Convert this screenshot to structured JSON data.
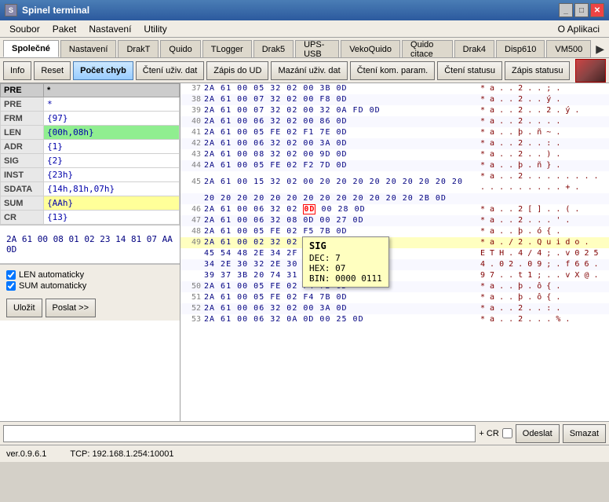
{
  "window": {
    "title": "Spinel terminal",
    "controls": [
      "_",
      "□",
      "✕"
    ]
  },
  "menu": {
    "items": [
      "Soubor",
      "Paket",
      "Nastavení",
      "Utility"
    ],
    "right": "O Aplikaci"
  },
  "tabs_top": {
    "items": [
      "Společné",
      "Nastavení",
      "DrakT",
      "Quido",
      "TLogger",
      "Drak5",
      "UPS-USB",
      "VekoQuido",
      "Quido citace",
      "Drak4",
      "Disp610",
      "VM500"
    ],
    "active": 0,
    "nav": "▶"
  },
  "buttons": {
    "items": [
      "Info",
      "Reset",
      "Počet chyb",
      "Čtení uživ. dat",
      "Zápis do UD",
      "Mazání uživ. dat",
      "Čtení kom. param.",
      "Čtení statusu",
      "Zápis statusu"
    ],
    "active": 2
  },
  "fields": [
    {
      "label": "PRE",
      "value": "*",
      "style": ""
    },
    {
      "label": "FRM",
      "value": "{97}",
      "style": ""
    },
    {
      "label": "LEN",
      "value": "{00h,08h}",
      "style": "green"
    },
    {
      "label": "ADR",
      "value": "{1}",
      "style": ""
    },
    {
      "label": "SIG",
      "value": "{2}",
      "style": ""
    },
    {
      "label": "INST",
      "value": "{23h}",
      "style": ""
    },
    {
      "label": "SDATA",
      "value": "{14h,81h,07h}",
      "style": ""
    },
    {
      "label": "SUM",
      "value": "{AAh}",
      "style": "yellow"
    },
    {
      "label": "CR",
      "value": "{13}",
      "style": ""
    }
  ],
  "hex_rows": [
    {
      "num": "37",
      "bytes": "2A 61 00 05 32 02 00 3B 0D",
      "ascii": "* a . . 2 . . ; ."
    },
    {
      "num": "38",
      "bytes": "2A 61 00 07 32 02 00 F8 0D",
      "ascii": "* a . . 2 . . ý ."
    },
    {
      "num": "39",
      "bytes": "2A 61 00 07 32 02 00 32 0A FD 0D",
      "ascii": "* a . . 2 . . 2 . ý ."
    },
    {
      "num": "40",
      "bytes": "2A 61 00 06 32 02 00 86 0D",
      "ascii": "* a . . 2 . . . ."
    },
    {
      "num": "41",
      "bytes": "2A 61 00 05 FE 02 F1 7E 0D",
      "ascii": "* a . . þ . ñ ~ ."
    },
    {
      "num": "42",
      "bytes": "2A 61 00 06 32 02 00 3A 0D",
      "ascii": "* a . . 2 . . : ."
    },
    {
      "num": "43",
      "bytes": "2A 61 00 08 32 02 00 9D 0D",
      "ascii": "* a . . 2 . . ) ."
    },
    {
      "num": "44",
      "bytes": "2A 61 00 05 FE 02 F2 7D 0D",
      "ascii": "* a . . þ . ñ } ."
    },
    {
      "num": "45",
      "bytes": "2A 61 00 15 32 02 00 20 20 20 20 20 20 20 20 20 20 20 20 20 20 20 2B 0D",
      "ascii": "* a . . 2 . . . . . . . . . . . . . . . . . + ."
    },
    {
      "num": "46",
      "bytes": "2A 61 00 06 32 02 00 0D 00 28 0D",
      "ascii": "* a . . 2 [ ] . . ( ."
    },
    {
      "num": "47",
      "bytes": "2A 61 00 06 32 08 0D 00 27 0D",
      "ascii": "* a . . 2 . . . ' ."
    },
    {
      "num": "48",
      "bytes": "2A 61 00 05 FE 02 F5 7B 0D",
      "ascii": "* a . . þ . ó { ."
    },
    {
      "num": "49",
      "bytes": "2A 61 00 02 32 02 00 20 ... 20 45 54 48 2E 34 2F 34 3B 76 30 32 35 34 2E 30 32 2E 30 39 3B 20 66 36 36 2E",
      "ascii": "* a . / 2 . Q u i d o . E T H . 4 / 4 ; . v 0 2 5 4 . 0 2 . 0 9 ; . f 6 6 ."
    },
    {
      "num": "50",
      "bytes": "2A 61 00 05 FE 02 F4 7B 0D",
      "ascii": "* a . . þ . ô { ."
    },
    {
      "num": "51",
      "bytes": "2A 61 00 06 32 02 00 3A 0D",
      "ascii": "* a . . 2 . . : ."
    },
    {
      "num": "52",
      "bytes": "2A 61 00 06 32 02 00 3A 0D",
      "ascii": "* a . . 2 . . : ."
    },
    {
      "num": "53",
      "bytes": "2A 61 00 06 32 0A 0D 00 25 0D",
      "ascii": "* a . . 2 . . . % ."
    }
  ],
  "tooltip": {
    "title": "SIG",
    "dec_label": "DEC:",
    "dec_value": "7",
    "hex_label": "HEX:",
    "hex_value": "07",
    "bin_label": "BIN:",
    "bin_value": "0000 0111"
  },
  "bottom_hex": "2A 61 00 08 01 02 23 14   81 07 AA 0D",
  "checkboxes": [
    {
      "label": "LEN automaticky",
      "checked": true
    },
    {
      "label": "SUM automaticky",
      "checked": true
    }
  ],
  "action_buttons": [
    "Uložit",
    "Poslat >>"
  ],
  "input_bar": {
    "placeholder": "",
    "plus_cr": "+ CR",
    "send_btn": "Odeslat",
    "clear_btn": "Smazat"
  },
  "status_bar": {
    "version": "ver.0.9.6.1",
    "connection": "TCP: 192.168.1.254:10001"
  }
}
